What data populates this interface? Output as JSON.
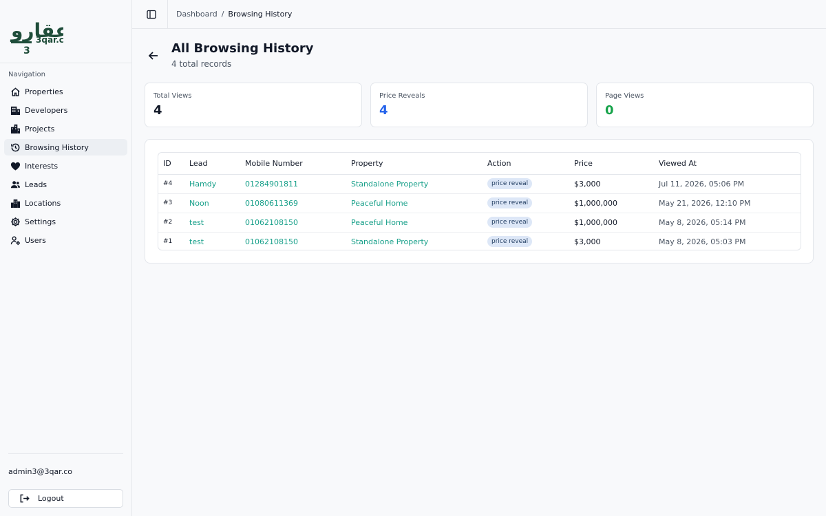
{
  "brand": {
    "logo_text": "3qar.co",
    "logo_arabic": "عقارو"
  },
  "nav": {
    "title": "Navigation",
    "items": [
      {
        "label": "Properties",
        "icon": "home-icon",
        "active": false
      },
      {
        "label": "Developers",
        "icon": "building-icon",
        "active": false
      },
      {
        "label": "Projects",
        "icon": "buildings-icon",
        "active": false
      },
      {
        "label": "Browsing History",
        "icon": "history-icon",
        "active": true
      },
      {
        "label": "Interests",
        "icon": "heart-icon",
        "active": false
      },
      {
        "label": "Leads",
        "icon": "users-icon",
        "active": false
      },
      {
        "label": "Locations",
        "icon": "city-icon",
        "active": false
      },
      {
        "label": "Settings",
        "icon": "gear-icon",
        "active": false
      },
      {
        "label": "Users",
        "icon": "user-cog-icon",
        "active": false
      }
    ]
  },
  "user": {
    "email": "admin3@3qar.co",
    "logout_label": "Logout"
  },
  "breadcrumb": {
    "parent": "Dashboard",
    "separator": "/",
    "current": "Browsing History"
  },
  "page": {
    "title": "All Browsing History",
    "subtitle": "4 total records"
  },
  "stats": [
    {
      "label": "Total Views",
      "value": "4",
      "color": "#111827"
    },
    {
      "label": "Price Reveals",
      "value": "4",
      "color": "#2563eb"
    },
    {
      "label": "Page Views",
      "value": "0",
      "color": "#16a34a"
    }
  ],
  "table": {
    "columns": [
      "ID",
      "Lead",
      "Mobile Number",
      "Property",
      "Action",
      "Price",
      "Viewed At"
    ],
    "rows": [
      {
        "id": "#4",
        "lead": "Hamdy",
        "mobile": "01284901811",
        "property": "Standalone Property",
        "action": "price reveal",
        "price": "$3,000",
        "viewed_at": "Jul 11, 2026, 05:06 PM"
      },
      {
        "id": "#3",
        "lead": "Noon",
        "mobile": "01080611369",
        "property": "Peaceful Home",
        "action": "price reveal",
        "price": "$1,000,000",
        "viewed_at": "May 21, 2026, 12:10 PM"
      },
      {
        "id": "#2",
        "lead": "test",
        "mobile": "01062108150",
        "property": "Peaceful Home",
        "action": "price reveal",
        "price": "$1,000,000",
        "viewed_at": "May 8, 2026, 05:14 PM"
      },
      {
        "id": "#1",
        "lead": "test",
        "mobile": "01062108150",
        "property": "Standalone Property",
        "action": "price reveal",
        "price": "$3,000",
        "viewed_at": "May 8, 2026, 05:03 PM"
      }
    ]
  },
  "colors": {
    "accent_link": "#18a08a",
    "brand_green": "#1f4d3a"
  }
}
